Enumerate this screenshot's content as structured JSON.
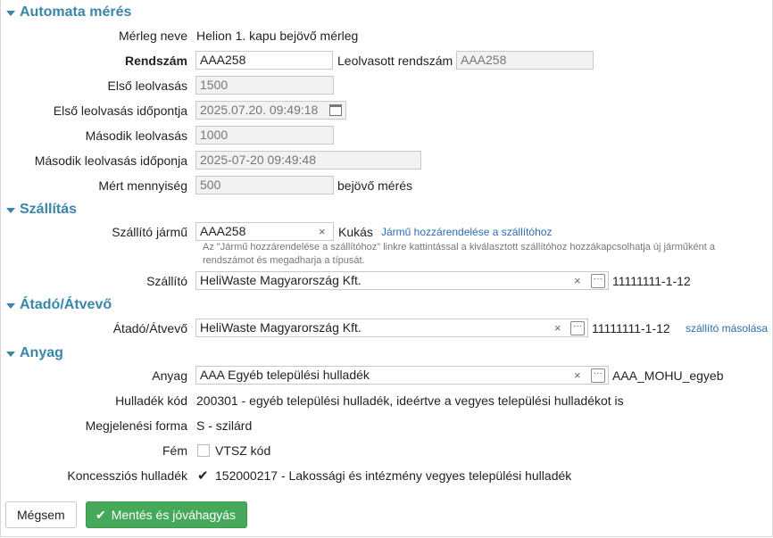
{
  "sections": {
    "automata": "Automata mérés",
    "szallitas": "Szállítás",
    "atado": "Átadó/Átvevő",
    "anyag": "Anyag"
  },
  "automata": {
    "merleg_label": "Mérleg neve",
    "merleg_value": "Helion 1. kapu bejövő mérleg",
    "rendszam_label": "Rendszám",
    "rendszam_value": "AAA258",
    "leolvasott_label": "Leolvasott rendszám",
    "leolvasott_value": "AAA258",
    "elso_label": "Első leolvasás",
    "elso_value": "1500",
    "elso_ido_label": "Első leolvasás időpontja",
    "elso_ido_value": "2025.07.20. 09:49:18",
    "masodik_label": "Második leolvasás",
    "masodik_value": "1000",
    "masodik_ido_label": "Második leolvasás időponja",
    "masodik_ido_value": "2025-07-20 09:49:48",
    "mert_label": "Mért mennyiség",
    "mert_value": "500",
    "mert_suffix": "bejövő mérés"
  },
  "szallitas": {
    "jarmu_label": "Szállító jármű",
    "jarmu_value": "AAA258",
    "jarmu_type": "Kukás",
    "jarmu_link": "Jármű hozzárendelése a szállítóhoz",
    "hint": "Az \"Jármű hozzárendelése a szállítóhoz\" linkre kattintással a kiválasztott szállítóhoz hozzákapcsolhatja új járműként a rendszámot és megadharja a típusát.",
    "szallito_label": "Szállító",
    "szallito_value": "HeliWaste Magyarország Kft.",
    "szallito_code": "11111111-1-12"
  },
  "atado": {
    "label": "Átadó/Átvevő",
    "value": "HeliWaste Magyarország Kft.",
    "code": "11111111-1-12",
    "link": "szállító másolása"
  },
  "anyag": {
    "anyag_label": "Anyag",
    "anyag_value": "AAA Egyéb települési hulladék",
    "anyag_code": "AAA_MOHU_egyeb",
    "kod_label": "Hulladék kód",
    "kod_value": "200301 - egyéb települési hulladék, ideértve a vegyes települési hulladékot is",
    "forma_label": "Megjelenési forma",
    "forma_value": "S - szilárd",
    "fem_label": "Fém",
    "fem_checked": false,
    "vtsz_label": "VTSZ kód",
    "konc_label": "Koncessziós hulladék",
    "konc_checked": true,
    "konc_value": "152000217 - Lakossági és intézmény vegyes települési hulladék"
  },
  "buttons": {
    "cancel": "Mégsem",
    "save": "Mentés és jóváhagyás"
  },
  "glyphs": {
    "clear": "×",
    "dots": "···",
    "check": "✔"
  }
}
